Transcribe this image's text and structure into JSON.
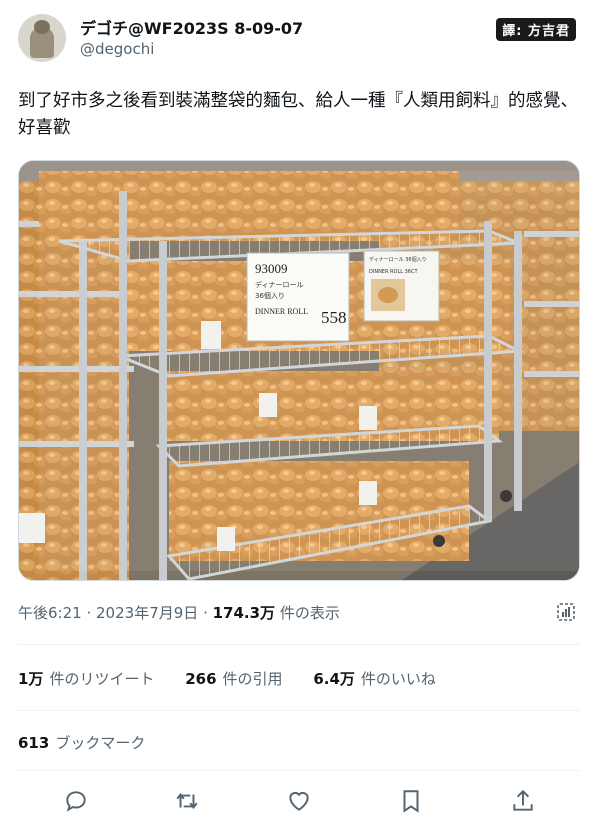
{
  "user": {
    "display_name": "デゴチ@WF2023S 8-09-07",
    "handle": "@degochi"
  },
  "badge": "譯: 方吉君",
  "tweet": {
    "text": "到了好市多之後看到裝滿整袋的麵包、給人一種『人類用飼料』的感覺、好喜歡"
  },
  "photo": {
    "sign_main": {
      "code": "93009",
      "jp_name": "ディナーロール",
      "jp_count": "36個入り",
      "en_name": "DINNER ROLL",
      "price": "558"
    },
    "sign_small": {
      "jp_name": "ディナーロール 36個入り",
      "en_name": "DINNER ROLL 36CT"
    }
  },
  "meta": {
    "time": "午後6:21",
    "date": "2023年7月9日",
    "views_count": "174.3万",
    "views_label": "件の表示"
  },
  "stats": {
    "retweets_count": "1万",
    "retweets_label": "件のリツイート",
    "quotes_count": "266",
    "quotes_label": "件の引用",
    "likes_count": "6.4万",
    "likes_label": "件のいいね"
  },
  "bookmarks": {
    "count": "613",
    "label": "ブックマーク"
  },
  "icons": {
    "actions": [
      "reply-icon",
      "retweet-icon",
      "like-icon",
      "bookmark-icon",
      "share-icon"
    ],
    "meta": "analytics-icon"
  },
  "colors": {
    "text_primary": "#0f1419",
    "text_secondary": "#536471",
    "divider": "#eff3f4"
  }
}
